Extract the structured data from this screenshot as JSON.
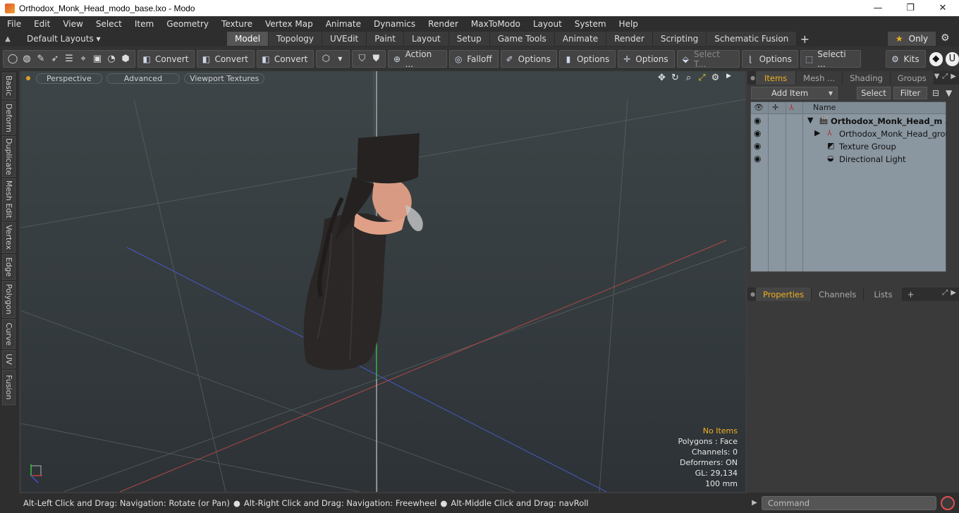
{
  "window": {
    "title": "Orthodox_Monk_Head_modo_base.lxo - Modo",
    "minimize": "—",
    "maximize": "❐",
    "close": "✕"
  },
  "menu": [
    "File",
    "Edit",
    "View",
    "Select",
    "Item",
    "Geometry",
    "Texture",
    "Vertex Map",
    "Animate",
    "Dynamics",
    "Render",
    "MaxToModo",
    "Layout",
    "System",
    "Help"
  ],
  "layouts": {
    "label": "Default Layouts ▾"
  },
  "tabs": [
    {
      "label": "Model",
      "active": true
    },
    {
      "label": "Topology"
    },
    {
      "label": "UVEdit"
    },
    {
      "label": "Paint"
    },
    {
      "label": "Layout"
    },
    {
      "label": "Setup"
    },
    {
      "label": "Game Tools"
    },
    {
      "label": "Animate"
    },
    {
      "label": "Render"
    },
    {
      "label": "Scripting"
    },
    {
      "label": "Schematic Fusion"
    }
  ],
  "tab_add": "+",
  "only_label": "Only",
  "toolbar": {
    "convert1": "Convert",
    "convert2": "Convert",
    "convert3": "Convert",
    "action": "Action ...",
    "falloff": "Falloff",
    "options1": "Options",
    "options2": "Options",
    "options3": "Options",
    "select_t": "Select T...",
    "options4": "Options",
    "selecti": "Selecti ...",
    "kits": "Kits"
  },
  "side_tabs": [
    "Basic",
    "Deform",
    "Duplicate",
    "Mesh Edit",
    "Vertex",
    "Edge",
    "Polygon",
    "Curve",
    "UV",
    "Fusion"
  ],
  "viewport": {
    "perspective": "Perspective",
    "advanced": "Advanced",
    "viewport_textures": "Viewport Textures",
    "info": {
      "no_items": "No Items",
      "polygons": "Polygons : Face",
      "channels": "Channels: 0",
      "deformers": "Deformers: ON",
      "gl": "GL: 29,134",
      "scale": "100 mm"
    }
  },
  "status": {
    "hint1": "Alt-Left Click and Drag: Navigation: Rotate (or Pan)",
    "hint2": "Alt-Right Click and Drag: Navigation: Freewheel",
    "hint3": "Alt-Middle Click and Drag: navRoll"
  },
  "items_panel": {
    "tabs": [
      "Items",
      "Mesh ...",
      "Shading",
      "Groups"
    ],
    "add_item": "Add Item",
    "select": "Select",
    "filter": "Filter",
    "name_header": "Name",
    "rows": [
      {
        "label": "Orthodox_Monk_Head_m ...",
        "type": "scene"
      },
      {
        "label": "Orthodox_Monk_Head_group",
        "type": "group"
      },
      {
        "label": "Texture Group",
        "type": "texture"
      },
      {
        "label": "Directional Light",
        "type": "light"
      }
    ]
  },
  "properties_panel": {
    "tabs": [
      "Properties",
      "Channels",
      "Lists"
    ],
    "add": "+"
  },
  "command": {
    "placeholder": "Command"
  },
  "colors": {
    "accent": "#f0b020",
    "axis_x": "#c04040",
    "axis_y": "#40c040",
    "axis_z": "#4050d0"
  }
}
